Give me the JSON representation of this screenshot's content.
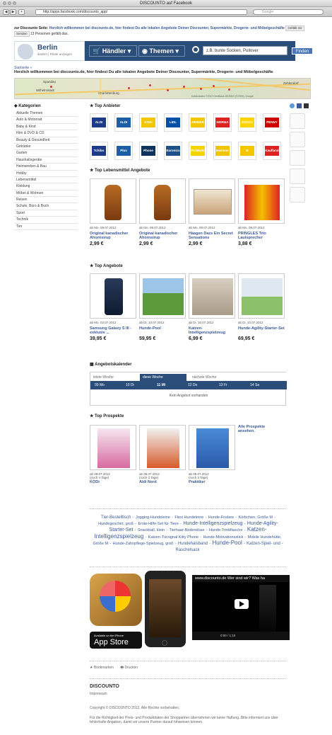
{
  "window": {
    "title": "DISCOUNTO auf Facebook"
  },
  "browser": {
    "url": "http://apps.facebook.com/discounto_app/",
    "search_placeholder": "Google"
  },
  "fb": {
    "prefix": "zur Discounto Seite:",
    "headline": "Herzlich willkommen bei discounto.de, hier findest Du alle lokalen Angebote Deiner Discounter, Supermärkte, Drogerie- und Möbelgeschäfte",
    "like": "Gefällt mir",
    "send": "Senden",
    "likes_text": "13 Personen gefällt das."
  },
  "header": {
    "city": "Berlin",
    "city_sub": "ändern | Filiale anzeigen",
    "nav_dealers": "Händler",
    "nav_themes": "Themen",
    "search_placeholder": "z.B. bunte Socken, Pullover",
    "search_button": "Finden"
  },
  "breadcrumb": "Startseite »",
  "welcome": "Herzlich willkommen bei discounto.de, hier findest Du alle lokalen Angebote Deiner Discounter, Supermärkte, Drogerie- und Möbelgeschäfte",
  "map": {
    "labels": [
      "Spandau",
      "Charlottenburg",
      "Wilhelmstadt",
      "Zehlendorf"
    ],
    "attribution": "Kartendaten ©2012 GeoBasis-DE/BKG (©2009), Google"
  },
  "categories": {
    "title": "Kategorien",
    "items": [
      "Aktuelle Themen",
      "Auto & Motorrad",
      "Baby & Kind",
      "Film & DVD & CD",
      "Beauty & Gesundheit",
      "Getränke",
      "Garten",
      "Haushaltsgeräte",
      "Heimwerken & Bau",
      "Hobby",
      "Lebensmittel",
      "Kleidung",
      "Möbel & Wohnen",
      "Reisen",
      "Schule, Büro & Buch",
      "Sport",
      "Technik",
      "Tier"
    ]
  },
  "top_dealers": {
    "title": "Top Anbieter",
    "logos": [
      {
        "name": "ALDI",
        "color": "#1d3b87"
      },
      {
        "name": "ALDI",
        "color": "#1d5fa5"
      },
      {
        "name": "KODi",
        "color": "#f2c600"
      },
      {
        "name": "LIDL",
        "color": "#0050aa"
      },
      {
        "name": "ZIMMER",
        "color": "#f2c600"
      },
      {
        "name": "NORMA",
        "color": "#d22"
      },
      {
        "name": "EDEKA",
        "color": "#ffd200"
      },
      {
        "name": "PENNY",
        "color": "#cc0000"
      },
      {
        "name": "Tchibo",
        "color": "#1d3b87"
      },
      {
        "name": "Plus",
        "color": "#1d5fa5"
      },
      {
        "name": "Phone House",
        "color": "#10335c"
      },
      {
        "name": "Euronics",
        "color": "#1d4f8a"
      },
      {
        "name": "ProMarkt",
        "color": "#f6d400"
      },
      {
        "name": "Hammer",
        "color": "#f0c400"
      },
      {
        "name": "B",
        "color": "#f2c600"
      },
      {
        "name": "Kaufland",
        "color": "#d22"
      }
    ]
  },
  "top_food": {
    "title": "Top Lebensmittel Angebote",
    "items": [
      {
        "meta": "ab Mo. 09.07.2012",
        "name": "Original kanadischer Ahornsirup",
        "price": "2,99 €"
      },
      {
        "meta": "ab Mo. 09.07.2012",
        "name": "Original kanadischer Ahornsirup",
        "price": "2,99 €"
      },
      {
        "meta": "ab Mo. 09.07.2012",
        "name": "Häagen Dazs Ein Secret Sensations",
        "price": "2,99 €"
      },
      {
        "meta": "ab Mo. 09.07.2012",
        "name": "PRINGLES Trio Lautsprecher",
        "price": "3,88 €"
      }
    ]
  },
  "top_offers": {
    "title": "Top Angebote",
    "items": [
      {
        "meta": "ab Mo. 02.07.2012",
        "name": "Samsung Galaxy S III - exklusiv ...",
        "price": "39,95 €"
      },
      {
        "meta": "ab Di. 10.07.2012",
        "name": "Hunde-Pool",
        "price": "59,95 €"
      },
      {
        "meta": "ab Di. 10.07.2012",
        "name": "Katzen-Intelligenzspielzeug",
        "price": "6,99 €"
      },
      {
        "meta": "ab Di. 10.07.2012",
        "name": "Hunde-Agility-Starter-Set",
        "price": "69,95 €"
      }
    ]
  },
  "calendar": {
    "title": "Angebotskalender",
    "tabs": [
      "letzte Woche",
      "diese Woche",
      "nächste Woche"
    ],
    "days": [
      "09 Mo",
      "10 Di",
      "11 Mi",
      "12 Do",
      "13 Fr",
      "14 Sa"
    ],
    "empty": "Kein Angebot vorhanden"
  },
  "prospects": {
    "title": "Top Prospekte",
    "all_link": "Alle Prospekte ansehen.",
    "items": [
      {
        "meta": "ab 09.07.2012",
        "sub": "(noch 4 Tage)",
        "name": "KODi"
      },
      {
        "meta": "ab 09.07.2012",
        "sub": "(noch 3 Tage)",
        "name": "Aldi Nord"
      },
      {
        "meta": "ab 09.07.2012",
        "sub": "(noch 3 Tage)",
        "name": "Praktiker"
      }
    ]
  },
  "tags": [
    "Tier-Bestelltisch",
    "Jogging-Hundeleine",
    "Flexi Hundeleine",
    "Hunde-Frisbee",
    "Körbchen, Größe M",
    "Hundegeschirr, groß",
    "Erste-Hilfe-Set für Tiere",
    "Hunde-Intelligenzspielzeug",
    "Hunde-Agility-Starter-Set",
    "Snackball, klein",
    "Tierhaar-Bodendüse",
    "Hunde-Trinkflasche",
    "Katzen-Intelligenzspielzeug",
    "Katzen-Türsignal Kitty Phone",
    "Hunde-Motivationsstick",
    "Mobile Hundehütte, Größe M",
    "Hunde-Zahnpflege-Spielzeug, groß",
    "Hundehalsband",
    "Hunde-Pool",
    "Katzen-Spiel- und -Raschelsack"
  ],
  "app": {
    "store_small": "Available on the iPhone",
    "store": "App Store",
    "video_title": "www.discounto.de Wer sind wir? Was ha",
    "video_time": "0:00 / 1:10"
  },
  "footer": {
    "bookmark": "Bookmarken",
    "print": "Drucken",
    "logo": "DISCOUNTO",
    "impressum": "Impressum",
    "copyright": "Copyright © DISCOUNTO 2012, Alle Rechte vorbehalten.",
    "disclaimer": "Für die Richtigkeit der Preis- und Produktdaten der Shoppartner übernehmen wir keine Haftung. Bitte informiert uns über fehlerhafte Angaben, damit wir unsere Partner darauf hinweisen können."
  }
}
